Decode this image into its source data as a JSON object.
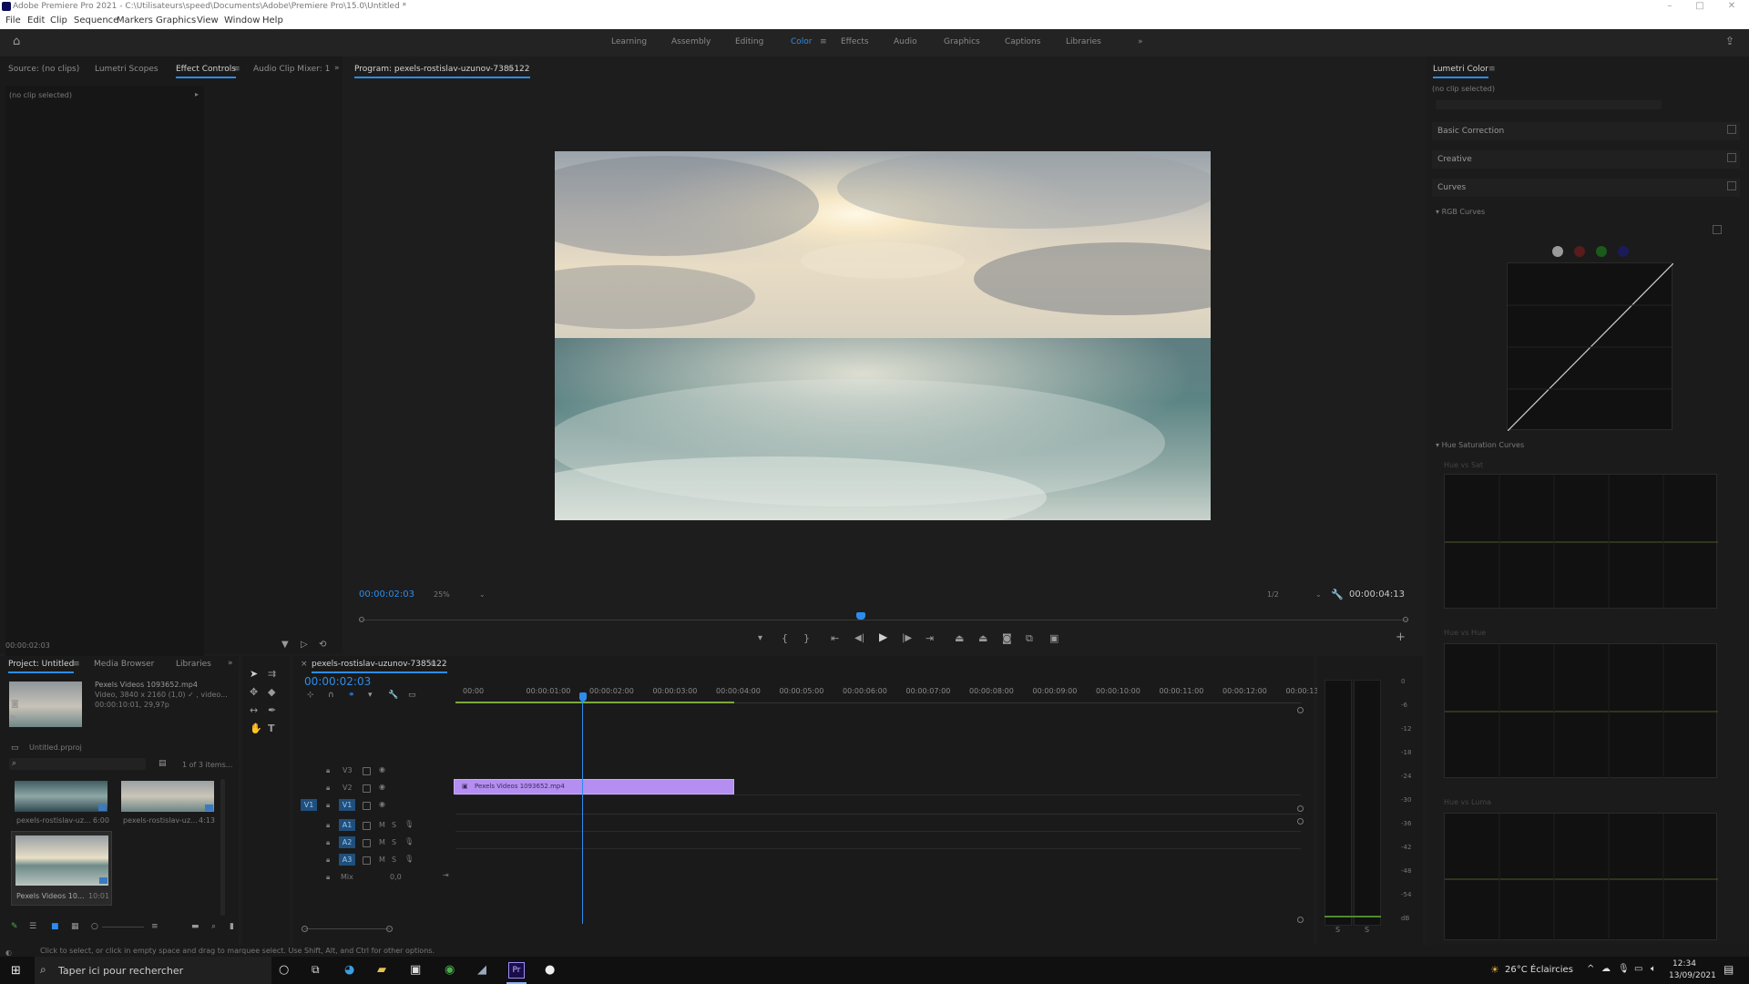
{
  "titlebar": {
    "title": "Adobe Premiere Pro 2021 - C:\\Utilisateurs\\speed\\Documents\\Adobe\\Premiere Pro\\15.0\\Untitled *"
  },
  "menubar": {
    "items": [
      "File",
      "Edit",
      "Clip",
      "Sequence",
      "Markers",
      "Graphics",
      "View",
      "Window",
      "Help"
    ]
  },
  "workspaces": {
    "items": [
      "Learning",
      "Assembly",
      "Editing",
      "Color",
      "Effects",
      "Audio",
      "Graphics",
      "Captions",
      "Libraries"
    ],
    "active": "Color"
  },
  "source_panel": {
    "tabs": [
      "Source: (no clips)",
      "Lumetri Scopes",
      "Effect Controls",
      "Audio Clip Mixer: 1"
    ],
    "active_tab": "Effect Controls",
    "no_clip": "(no clip selected)",
    "timecode": "00:00:02:03"
  },
  "program_monitor": {
    "title": "Program: pexels-rostislav-uzunov-7385122",
    "timecode": "00:00:02:03",
    "zoom": "25%",
    "resolution": "1/2",
    "duration": "00:00:04:13",
    "playhead_fraction": 0.478
  },
  "project_panel": {
    "tabs": [
      "Project: Untitled",
      "Media Browser",
      "Libraries"
    ],
    "active_tab": "Project: Untitled",
    "preview_name": "Pexels Videos 1093652.mp4",
    "preview_info1": "Video, 3840 x 2160 (1,0) ✓ , video...",
    "preview_info2": "00:00:10:01, 29,97p",
    "project_file": "Untitled.prproj",
    "item_count": "1 of 3 items...",
    "clips": [
      {
        "name": "pexels-rostislav-uz...",
        "duration": "6:00"
      },
      {
        "name": "pexels-rostislav-uz...",
        "duration": "4:13"
      },
      {
        "name": "Pexels Videos 10...",
        "duration": "10:01"
      }
    ]
  },
  "timeline": {
    "tab": "pexels-rostislav-uzunov-7385122",
    "timecode": "00:00:02:03",
    "ruler": [
      "00:00",
      "00:00:01:00",
      "00:00:02:00",
      "00:00:03:00",
      "00:00:04:00",
      "00:00:05:00",
      "00:00:06:00",
      "00:00:07:00",
      "00:00:08:00",
      "00:00:09:00",
      "00:00:10:00",
      "00:00:11:00",
      "00:00:12:00",
      "00:00:13:00"
    ],
    "tracks_video": [
      "V3",
      "V2",
      "V1"
    ],
    "tracks_audio": [
      "A1",
      "A2",
      "A3"
    ],
    "mix_label": "Mix",
    "mix_value": "0,0",
    "clip_label": "Pexels Videos 1093652.mp4",
    "meter_ticks": [
      "0",
      "-6",
      "-12",
      "-18",
      "-24",
      "-30",
      "-36",
      "-42",
      "-48",
      "-54",
      "dB"
    ]
  },
  "lumetri": {
    "title": "Lumetri Color",
    "no_clip": "(no clip selected)",
    "sections": [
      "Basic Correction",
      "Creative",
      "Curves"
    ],
    "rgb_curves": "RGB Curves",
    "hue_sat": "Hue Saturation Curves",
    "hue_boxes": [
      "Hue vs Sat",
      "Hue vs Hue",
      "Hue vs Luma"
    ]
  },
  "statusbar": {
    "text": "Click to select, or click in empty space and drag to marquee select. Use Shift, Alt, and Ctrl for other options."
  },
  "taskbar": {
    "search_placeholder": "Taper ici pour rechercher",
    "weather": "26°C  Éclaircies",
    "time": "12:34",
    "date": "13/09/2021"
  },
  "colors": {
    "accent": "#2d8ceb",
    "clip": "#b48ef0",
    "panel": "#1a1a1a"
  }
}
